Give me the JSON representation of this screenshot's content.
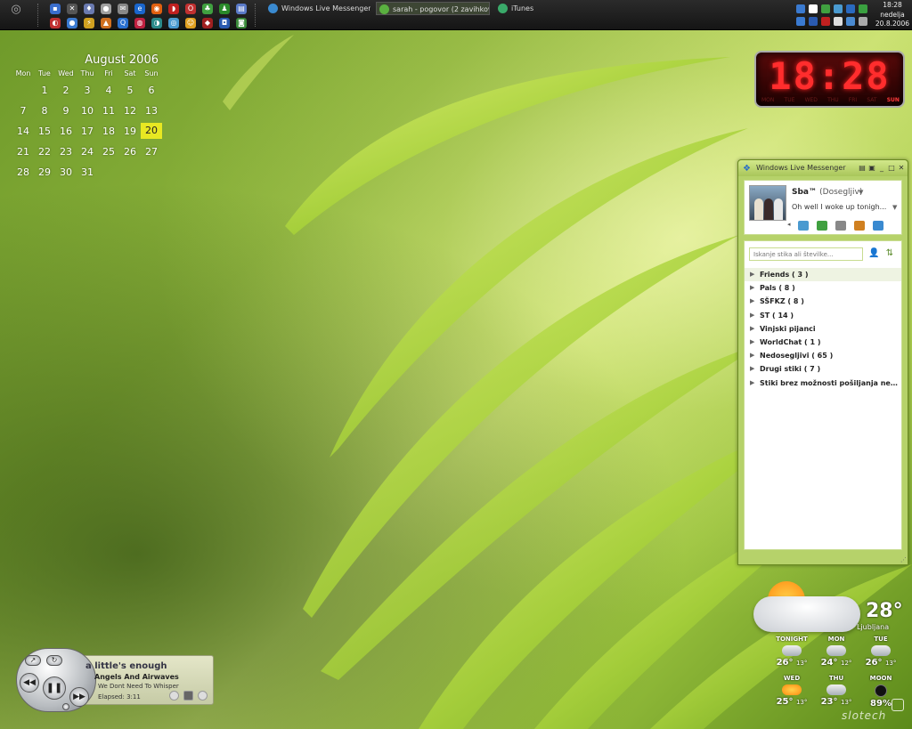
{
  "taskbar": {
    "tasks": [
      {
        "label": "Windows Live Messenger",
        "icon": "messenger-icon"
      },
      {
        "label": "sarah - pogovor (2 zavihkov)",
        "icon": "chat-icon"
      },
      {
        "label": "iTunes",
        "icon": "itunes-icon"
      }
    ],
    "clock": {
      "time": "18:28",
      "day": "nedelja",
      "date": "20.8.2006"
    }
  },
  "calendar": {
    "title": "August 2006",
    "weekdays": [
      "Mon",
      "Tue",
      "Wed",
      "Thu",
      "Fri",
      "Sat",
      "Sun"
    ],
    "weeks": [
      [
        "",
        "1",
        "2",
        "3",
        "4",
        "5",
        "6"
      ],
      [
        "7",
        "8",
        "9",
        "10",
        "11",
        "12",
        "13"
      ],
      [
        "14",
        "15",
        "16",
        "17",
        "18",
        "19",
        "20"
      ],
      [
        "21",
        "22",
        "23",
        "24",
        "25",
        "26",
        "27"
      ],
      [
        "28",
        "29",
        "30",
        "31",
        "",
        "",
        ""
      ]
    ],
    "today": "20"
  },
  "digital_clock": {
    "time": "18:28",
    "days": [
      "MON",
      "TUE",
      "WED",
      "THU",
      "FRI",
      "SAT",
      "SUN"
    ],
    "active_day": "SUN"
  },
  "messenger": {
    "title": "Windows Live Messenger",
    "profile": {
      "name": "Sba™",
      "status": "(Dosegljiv)",
      "message": "Oh well I woke up tonigh..."
    },
    "search_placeholder": "Iskanje stika ali številke...",
    "groups": [
      "Friends ( 3 )",
      "Pals ( 8 )",
      "SŠFKZ ( 8 )",
      "ST ( 14 )",
      "Vinjski pijanci",
      "WorldChat ( 1 )",
      "Nedosegljivi ( 65 )",
      "Drugi stiki ( 7 )",
      "Stiki brez možnosti pošiljanja nep..."
    ]
  },
  "weather": {
    "current_temp": "28°",
    "city": "Ljubljana",
    "forecast": [
      {
        "day": "TONIGHT",
        "high": "",
        "low": ""
      },
      {
        "day": "MON",
        "high": "",
        "low": ""
      },
      {
        "day": "TUE",
        "high": "",
        "low": ""
      },
      {
        "day": "",
        "high": "26°",
        "low": "13°"
      },
      {
        "day": "",
        "high": "24°",
        "low": "12°"
      },
      {
        "day": "",
        "high": "26°",
        "low": "13°"
      },
      {
        "day": "WED",
        "high": "",
        "low": ""
      },
      {
        "day": "THU",
        "high": "",
        "low": ""
      },
      {
        "day": "MOON",
        "high": "",
        "low": ""
      },
      {
        "day": "",
        "high": "25°",
        "low": "13°"
      },
      {
        "day": "",
        "high": "23°",
        "low": "13°"
      },
      {
        "day": "",
        "high": "89%",
        "low": ""
      }
    ]
  },
  "player": {
    "song": "a little's enough",
    "artist": "Angels And Airwaves",
    "album": "We Dont Need To Whisper",
    "elapsed": "Elapsed: 3:11"
  },
  "watermark": "slotech"
}
